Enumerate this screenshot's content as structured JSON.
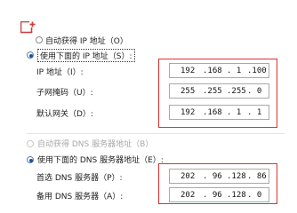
{
  "ip_section": {
    "auto_label": "自动获得 IP 地址（O）",
    "manual_label": "使用下面的 IP 地址（S）:",
    "fields": [
      {
        "label": "IP 地址（I）:",
        "octets": [
          "192",
          ".168",
          ". 1",
          ".100"
        ]
      },
      {
        "label": "子网掩码（U）:",
        "octets": [
          "255",
          ".255",
          ".255",
          ". 0"
        ]
      },
      {
        "label": "默认网关（D）:",
        "octets": [
          "192",
          ".168",
          ". 1",
          ". 1"
        ]
      }
    ]
  },
  "dns_section": {
    "auto_label": "自动获得 DNS 服务器地址（B）",
    "manual_label": "使用下面的 DNS 服务器地址（E）:",
    "fields": [
      {
        "label": "首选 DNS 服务器（P）:",
        "octets": [
          "202",
          ". 96",
          ".128",
          ". 86"
        ]
      },
      {
        "label": "备用 DNS 服务器（A）:",
        "octets": [
          "202",
          ". 96",
          ".128",
          ". 0"
        ]
      }
    ]
  },
  "colors": {
    "highlight": "#e03030",
    "accent": "#1f4fa0"
  }
}
